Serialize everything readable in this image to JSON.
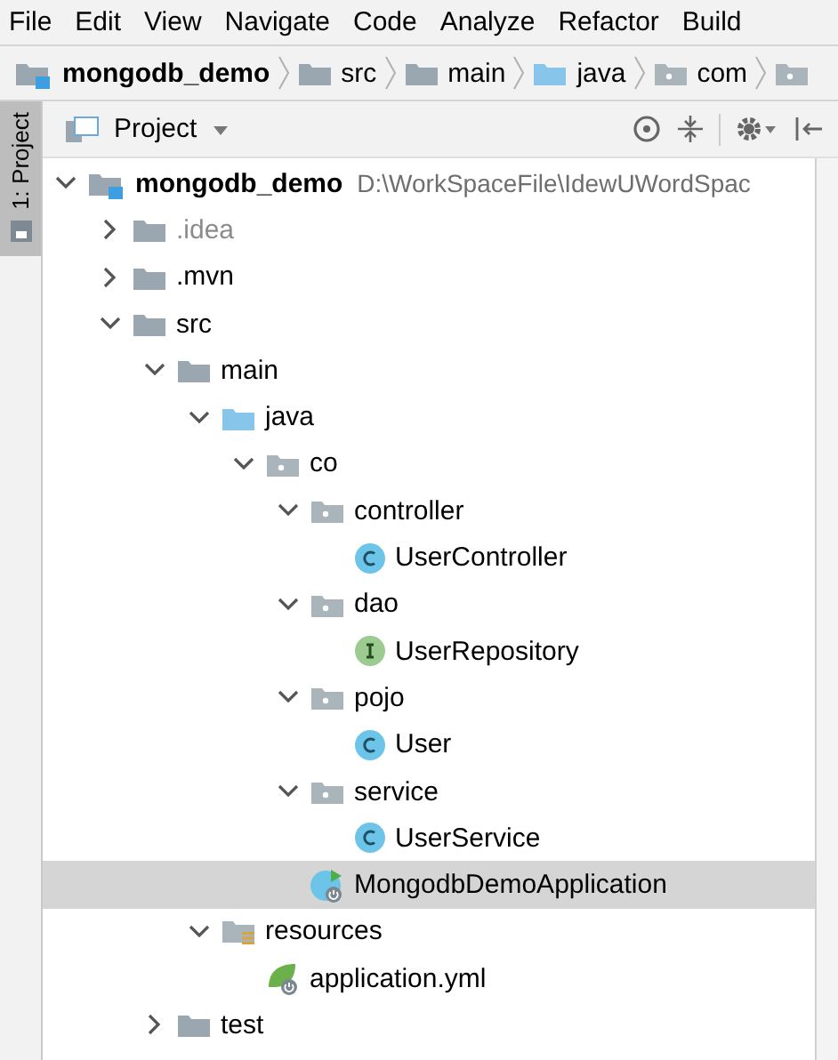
{
  "menu": [
    "File",
    "Edit",
    "View",
    "Navigate",
    "Code",
    "Analyze",
    "Refactor",
    "Build"
  ],
  "breadcrumbs": [
    {
      "kind": "module",
      "label": "mongodb_demo"
    },
    {
      "kind": "folder",
      "label": "src"
    },
    {
      "kind": "folder",
      "label": "main"
    },
    {
      "kind": "source",
      "label": "java"
    },
    {
      "kind": "package",
      "label": "com"
    },
    {
      "kind": "package"
    }
  ],
  "side_tab": {
    "label": "1: Project",
    "selected": true
  },
  "panel": {
    "title": "Project"
  },
  "tree": [
    {
      "kind": "module",
      "name": "mongodb_demo",
      "path": "D:\\WorkSpaceFile\\IdewUWordSpac",
      "expanded": true,
      "selected": false,
      "children": [
        {
          "kind": "folder",
          "name": ".idea",
          "expanded": false,
          "dimmed": true,
          "selected": false
        },
        {
          "kind": "folder",
          "name": ".mvn",
          "expanded": false,
          "selected": false
        },
        {
          "kind": "folder",
          "name": "src",
          "expanded": true,
          "selected": false,
          "children": [
            {
              "kind": "folder",
              "name": "main",
              "expanded": true,
              "selected": false,
              "children": [
                {
                  "kind": "source",
                  "name": "java",
                  "expanded": true,
                  "selected": false,
                  "children": [
                    {
                      "kind": "package",
                      "name": "co",
                      "expanded": true,
                      "selected": false,
                      "children": [
                        {
                          "kind": "package",
                          "name": "controller",
                          "expanded": true,
                          "selected": false,
                          "children": [
                            {
                              "kind": "class",
                              "name": "UserController",
                              "selected": false
                            }
                          ]
                        },
                        {
                          "kind": "package",
                          "name": "dao",
                          "expanded": true,
                          "selected": false,
                          "children": [
                            {
                              "kind": "interface",
                              "name": "UserRepository",
                              "selected": false
                            }
                          ]
                        },
                        {
                          "kind": "package",
                          "name": "pojo",
                          "expanded": true,
                          "selected": false,
                          "children": [
                            {
                              "kind": "class",
                              "name": "User",
                              "selected": false
                            }
                          ]
                        },
                        {
                          "kind": "package",
                          "name": "service",
                          "expanded": true,
                          "selected": false,
                          "children": [
                            {
                              "kind": "class",
                              "name": "UserService",
                              "selected": false
                            }
                          ]
                        },
                        {
                          "kind": "boot",
                          "name": "MongodbDemoApplication",
                          "selected": true
                        }
                      ]
                    }
                  ]
                },
                {
                  "kind": "resources",
                  "name": "resources",
                  "expanded": true,
                  "selected": false,
                  "children": [
                    {
                      "kind": "config",
                      "name": "application.yml",
                      "selected": false
                    }
                  ]
                }
              ]
            },
            {
              "kind": "folder",
              "name": "test",
              "expanded": false,
              "selected": false
            }
          ]
        }
      ]
    }
  ]
}
